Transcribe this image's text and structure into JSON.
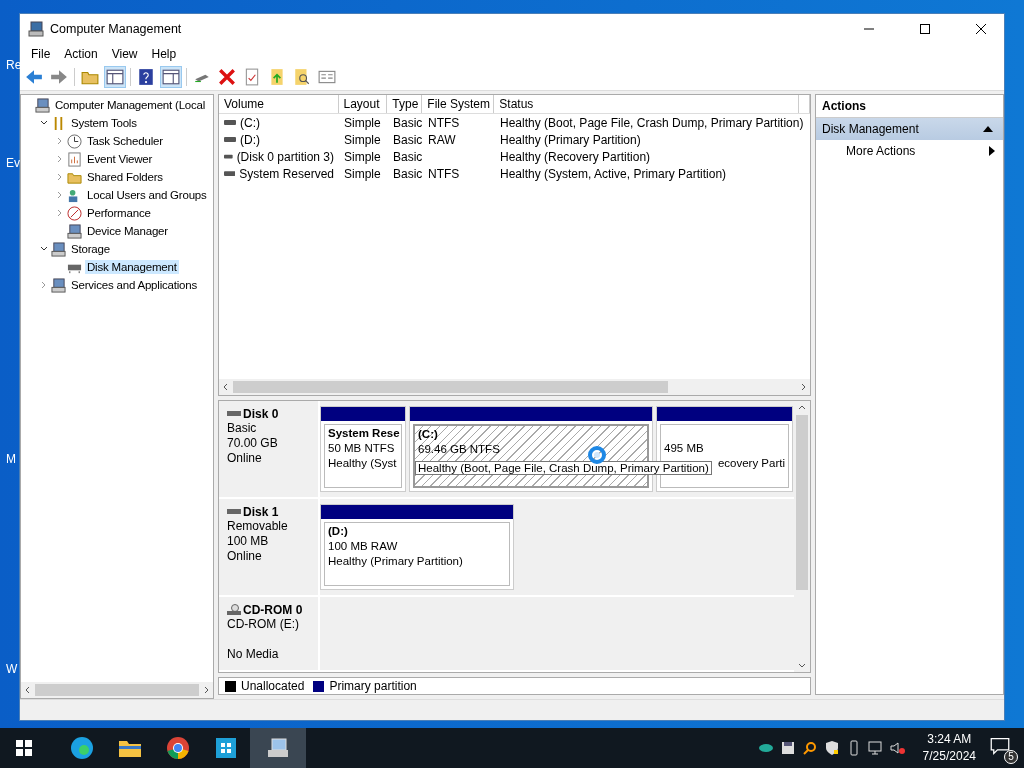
{
  "desktop_labels": [
    "Re",
    "Ev",
    "M",
    "W"
  ],
  "window": {
    "title": "Computer Management"
  },
  "menu": [
    "File",
    "Action",
    "View",
    "Help"
  ],
  "tree": [
    {
      "label": "Computer Management (Local",
      "selected": false,
      "children": [
        {
          "label": "System Tools",
          "selected": false,
          "expanded": true,
          "children": [
            {
              "label": "Task Scheduler",
              "selected": false,
              "expanded": false
            },
            {
              "label": "Event Viewer",
              "selected": false,
              "expanded": false
            },
            {
              "label": "Shared Folders",
              "selected": false,
              "expanded": false
            },
            {
              "label": "Local Users and Groups",
              "selected": false,
              "expanded": false
            },
            {
              "label": "Performance",
              "selected": false,
              "expanded": false
            },
            {
              "label": "Device Manager",
              "selected": false
            }
          ]
        },
        {
          "label": "Storage",
          "selected": false,
          "expanded": true,
          "children": [
            {
              "label": "Disk Management",
              "selected": true
            }
          ]
        },
        {
          "label": "Services and Applications",
          "selected": false,
          "expanded": false
        }
      ]
    }
  ],
  "volumes": {
    "columns": [
      "Volume",
      "Layout",
      "Type",
      "File System",
      "Status"
    ],
    "rows": [
      [
        "(C:)",
        "Simple",
        "Basic",
        "NTFS",
        "Healthy (Boot, Page File, Crash Dump, Primary Partition)"
      ],
      [
        "(D:)",
        "Simple",
        "Basic",
        "RAW",
        "Healthy (Primary Partition)"
      ],
      [
        "(Disk 0 partition 3)",
        "Simple",
        "Basic",
        null,
        "Healthy (Recovery Partition)"
      ],
      [
        "System Reserved",
        "Simple",
        "Basic",
        "NTFS",
        "Healthy (System, Active, Primary Partition)"
      ]
    ]
  },
  "disks": [
    {
      "name": "Disk 0",
      "kind": "disk",
      "lines": [
        "Basic",
        "70.00 GB",
        "Online"
      ],
      "partitions": [
        {
          "name": "System Rese",
          "size": "50 MB NTFS",
          "status": "Healthy (Syst",
          "selected": false
        },
        {
          "name": "(C:)",
          "size": "69.46 GB NTFS",
          "selected": true
        },
        {
          "size": "495 MB",
          "status": "ecovery Parti",
          "selected": false
        }
      ]
    },
    {
      "name": "Disk 1",
      "kind": "disk",
      "lines": [
        "Removable",
        "100 MB",
        "Online"
      ],
      "partitions": [
        {
          "name": "(D:)",
          "size": "100 MB RAW",
          "status": "Healthy (Primary Partition)",
          "selected": false
        }
      ]
    },
    {
      "name": "CD-ROM 0",
      "kind": "cdrom",
      "lines": [
        "CD-ROM (E:)",
        "No Media"
      ]
    }
  ],
  "tooltip": "Healthy (Boot, Page File, Crash Dump, Primary Partition)",
  "legend": [
    {
      "label": "Unallocated",
      "color": "#000000"
    },
    {
      "label": "Primary partition",
      "color": "#000080"
    }
  ],
  "actions": {
    "title": "Actions",
    "section": "Disk Management",
    "items": [
      "More Actions"
    ]
  },
  "taskbar": {
    "time": "3:24 AM",
    "date": "7/25/2024",
    "notifications": "5"
  }
}
